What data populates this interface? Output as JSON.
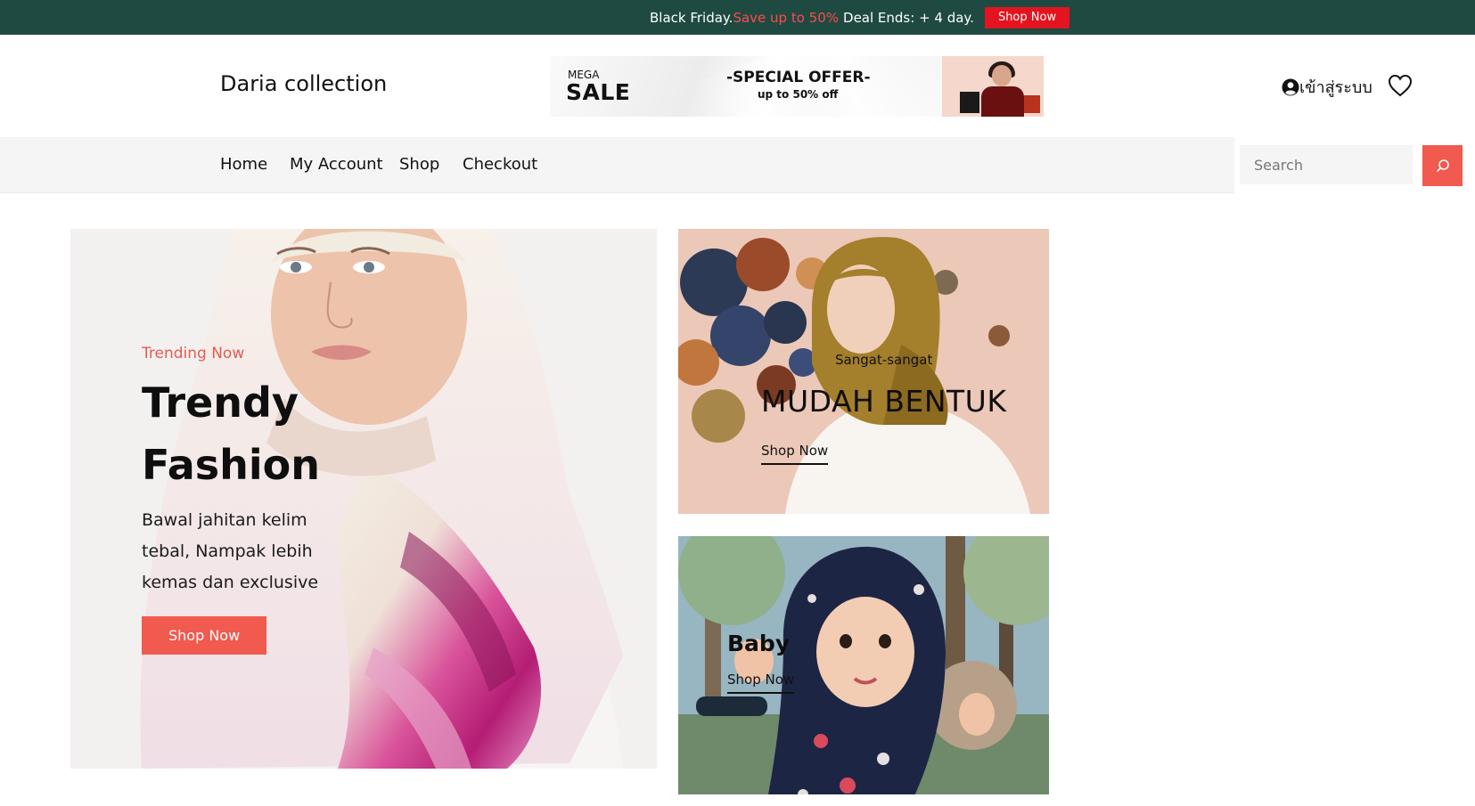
{
  "topbar": {
    "text_a": "Black Friday.",
    "text_b": "Save up to 50%",
    "text_c": "Deal Ends: + 4 day.",
    "button": "Shop Now"
  },
  "header": {
    "logo": "Daria collection",
    "banner": {
      "mega": "MEGA",
      "sale": "SALE",
      "offer": "-SPECIAL OFFER-",
      "off": "up to 50% off"
    },
    "account_label": "เข้าสู่ระบบ"
  },
  "nav": {
    "items": [
      "Home",
      "My Account",
      "Shop",
      "Checkout"
    ],
    "search_placeholder": "Search"
  },
  "hero": {
    "subtitle": "Trending Now",
    "title": "Trendy Fashion",
    "description": "Bawal jahitan kelim tebal, Nampak lebih kemas dan exclusive",
    "button": "Shop Now"
  },
  "panels": [
    {
      "subtitle": "Sangat-sangat",
      "title": "MUDAH BENTUK",
      "link": "Shop Now"
    },
    {
      "title": "Baby",
      "link": "Shop Now"
    }
  ],
  "colors": {
    "topbar_bg": "#1e4a42",
    "accent": "#f05a4f",
    "topbar_button": "#e3141f"
  },
  "icons": {
    "account": "user-circle-icon",
    "wishlist": "heart-icon",
    "search": "search-icon"
  }
}
